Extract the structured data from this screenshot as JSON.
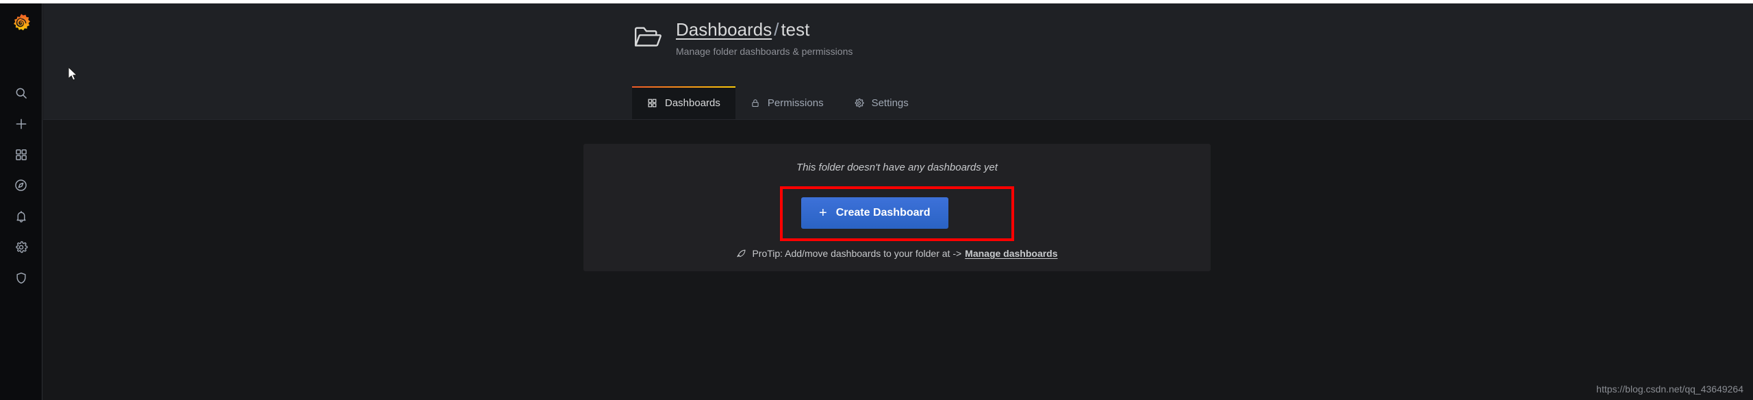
{
  "app": {
    "name": "Grafana",
    "accent_orange": "#f05a28",
    "accent_yellow": "#fbca0a",
    "primary_blue": "#3d71d9",
    "highlight_red": "#ff0000",
    "page_bg": "#161719",
    "panel_bg": "#212124",
    "header_bg": "#1f2125",
    "sidebar_bg": "#0b0c0e"
  },
  "sidebar": {
    "logo": {
      "name": "grafana-logo",
      "label": "Grafana"
    },
    "items": [
      {
        "icon": "search-icon",
        "label": "Search"
      },
      {
        "icon": "plus-icon",
        "label": "Create"
      },
      {
        "icon": "apps-grid-icon",
        "label": "Dashboards"
      },
      {
        "icon": "compass-icon",
        "label": "Explore"
      },
      {
        "icon": "bell-icon",
        "label": "Alerting"
      },
      {
        "icon": "gear-icon",
        "label": "Configuration"
      },
      {
        "icon": "shield-icon",
        "label": "Server Admin"
      }
    ]
  },
  "header": {
    "folder_icon": "folder-open-icon",
    "breadcrumb": {
      "parent": "Dashboards",
      "separator": "/",
      "current": "test"
    },
    "subtitle": "Manage folder dashboards & permissions",
    "tabs": [
      {
        "label": "Dashboards",
        "icon": "apps-grid-icon",
        "active": true
      },
      {
        "label": "Permissions",
        "icon": "lock-icon",
        "active": false
      },
      {
        "label": "Settings",
        "icon": "gear-icon",
        "active": false
      }
    ]
  },
  "main": {
    "empty_state_message": "This folder doesn't have any dashboards yet",
    "create_button": {
      "label": "Create Dashboard",
      "plus_glyph": "+"
    },
    "protip": {
      "icon": "rocket-icon",
      "text": "ProTip: Add/move dashboards to your folder at ->",
      "link_label": "Manage dashboards"
    }
  },
  "watermark": {
    "text": "https://blog.csdn.net/qq_43649264"
  }
}
